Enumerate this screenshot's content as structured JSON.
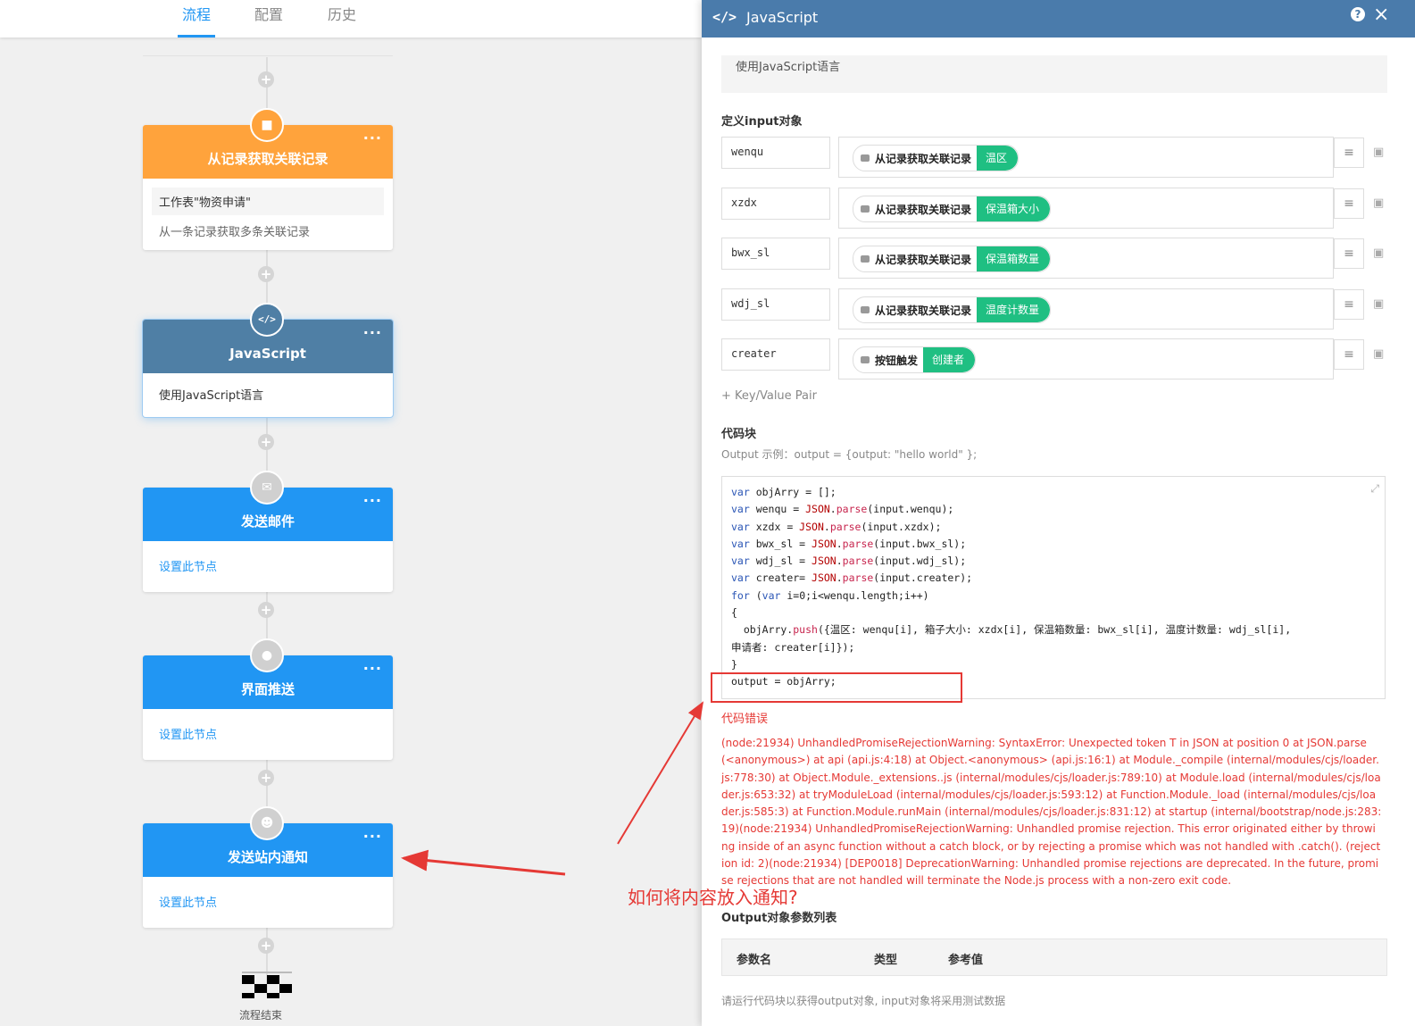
{
  "tabs": [
    {
      "label": "流程",
      "active": true
    },
    {
      "label": "配置",
      "active": false
    },
    {
      "label": "历史",
      "active": false
    }
  ],
  "flow": {
    "nodes": [
      {
        "title": "从记录获取关联记录",
        "icon": "truck-icon",
        "color": "#ffa33c",
        "sub": "工作表\"物资申请\"",
        "desc": "从一条记录获取多条关联记录"
      },
      {
        "title": "JavaScript",
        "icon": "code-icon",
        "color": "#4f7fa5",
        "desc": "使用JavaScript语言"
      },
      {
        "title": "发送邮件",
        "icon": "mail-icon",
        "color": "#2196f3",
        "link": "设置此节点"
      },
      {
        "title": "界面推送",
        "icon": "bell-icon",
        "color": "#2196f3",
        "link": "设置此节点"
      },
      {
        "title": "发送站内通知",
        "icon": "user-icon",
        "color": "#2196f3",
        "link": "设置此节点"
      }
    ],
    "end_label": "流程结束",
    "annotation": "如何将内容放入通知?"
  },
  "panel": {
    "title": "JavaScript",
    "description": "使用JavaScript语言",
    "input_label": "定义input对象",
    "inputs": [
      {
        "key": "wenqu",
        "source": "从记录获取关联记录",
        "field": "温区"
      },
      {
        "key": "xzdx",
        "source": "从记录获取关联记录",
        "field": "保温箱大小"
      },
      {
        "key": "bwx_sl",
        "source": "从记录获取关联记录",
        "field": "保温箱数量"
      },
      {
        "key": "wdj_sl",
        "source": "从记录获取关联记录",
        "field": "温度计数量"
      },
      {
        "key": "creater",
        "source": "按钮触发",
        "field": "创建者"
      }
    ],
    "add_pair": "+ Key/Value Pair",
    "code_label": "代码块",
    "code_hint": "Output 示例：output = {output: \"hello world\" };",
    "code_lines": [
      "var objArry = [];",
      "var wenqu = JSON.parse(input.wenqu);",
      "var xzdx = JSON.parse(input.xzdx);",
      "var bwx_sl = JSON.parse(input.bwx_sl);",
      "var wdj_sl = JSON.parse(input.wdj_sl);",
      "var creater= JSON.parse(input.creater);",
      "for (var i=0;i<wenqu.length;i++)",
      "{",
      "  objArry.push({温区: wenqu[i], 箱子大小: xzdx[i], 保温箱数量: bwx_sl[i], 温度计数量: wdj_sl[i],",
      "申请者: creater[i]});",
      "}",
      "output = objArry;"
    ],
    "error_label": "代码错误",
    "error_text": "(node:21934) UnhandledPromiseRejectionWarning: SyntaxError: Unexpected token T in JSON at position 0 at JSON.parse (<anonymous>) at api (api.js:4:18) at Object.<anonymous> (api.js:16:1) at Module._compile (internal/modules/cjs/loader.js:778:30) at Object.Module._extensions..js (internal/modules/cjs/loader.js:789:10) at Module.load (internal/modules/cjs/loader.js:653:32) at tryModuleLoad (internal/modules/cjs/loader.js:593:12) at Function.Module._load (internal/modules/cjs/loader.js:585:3) at Function.Module.runMain (internal/modules/cjs/loader.js:831:12) at startup (internal/bootstrap/node.js:283:19)(node:21934) UnhandledPromiseRejectionWarning: Unhandled promise rejection. This error originated either by throwing inside of an async function without a catch block, or by rejecting a promise which was not handled with .catch(). (rejection id: 2)(node:21934) [DEP0018] DeprecationWarning: Unhandled promise rejections are deprecated. In the future, promise rejections that are not handled will terminate the Node.js process with a non-zero exit code.",
    "output_label": "Output对象参数列表",
    "output_columns": [
      "参数名",
      "类型",
      "参考值"
    ],
    "output_note": "请运行代码块以获得output对象, input对象将采用测试数据"
  },
  "colors": {
    "accent": "#2196f3",
    "panel_header": "#4a7bab",
    "error": "#e53935",
    "field_chip": "#1fbf82"
  }
}
